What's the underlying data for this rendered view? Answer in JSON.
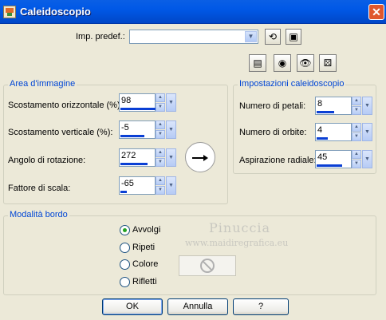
{
  "window": {
    "title": "Caleidoscopio",
    "close_glyph": "✕"
  },
  "presets": {
    "label": "Imp. predef.:",
    "value": ""
  },
  "icons": {
    "preset_reset": "reset-icon",
    "preset_save": "save-icon",
    "toolbar": [
      "window-icon",
      "eye-icon",
      "eye-open-icon",
      "dice-icon"
    ]
  },
  "area_group": {
    "title": "Area d'immagine",
    "fields": [
      {
        "label": "Scostamento orizzontale (%):",
        "value": "98"
      },
      {
        "label": "Scostamento verticale (%):",
        "value": "-5"
      },
      {
        "label": "Angolo di rotazione:",
        "value": "272"
      },
      {
        "label": "Fattore di scala:",
        "value": "-65"
      }
    ]
  },
  "kaleido_group": {
    "title": "Impostazioni caleidoscopio",
    "fields": [
      {
        "label": "Numero di petali:",
        "value": "8"
      },
      {
        "label": "Numero di orbite:",
        "value": "4"
      },
      {
        "label": "Aspirazione radiale:",
        "value": "45"
      }
    ]
  },
  "edge_group": {
    "title": "Modalità bordo",
    "options": [
      "Avvolgi",
      "Ripeti",
      "Colore",
      "Rifletti"
    ],
    "selected": "Avvolgi"
  },
  "watermark": {
    "line1": "Pinuccia",
    "line2": "www.maidiregrafica.eu"
  },
  "buttons": {
    "ok": "OK",
    "cancel": "Annulla",
    "help": "?"
  }
}
